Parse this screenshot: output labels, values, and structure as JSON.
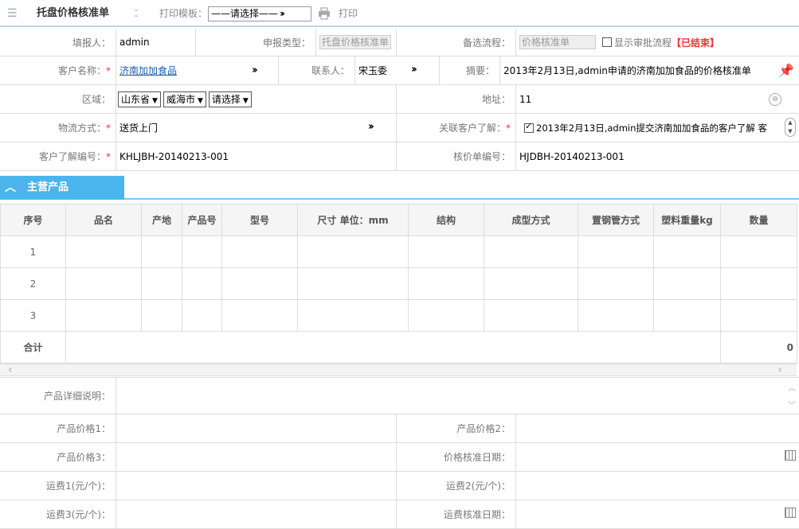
{
  "toolbar": {
    "title": "托盘价格核准单",
    "print_template_label": "打印模板：",
    "print_template_value": "——请选择——",
    "print_label": "打印"
  },
  "form": {
    "reporter_label": "填报人：",
    "reporter_value": "admin",
    "report_type_label": "申报类型：",
    "report_type_value": "托盘价格核准单",
    "alt_flow_label": "备选流程：",
    "alt_flow_value": "价格核准单",
    "show_flow_label": "显示审批流程",
    "status_text": "【已结束】",
    "customer_label": "客户名称：",
    "customer_value": "济南加加食品",
    "contact_label": "联系人：",
    "contact_value": "宋玉委",
    "summary_label": "摘要：",
    "summary_value": "2013年2月13日,admin申请的济南加加食品的价格核准单",
    "region_label": "区域：",
    "province": "山东省",
    "city": "威海市",
    "district": "请选择",
    "address_label": "地址：",
    "address_value": "11",
    "logistics_label": "物流方式：",
    "logistics_value": "送货上门",
    "related_label": "关联客户了解：",
    "related_value": "2013年2月13日,admin提交济南加加食品的客户了解 客",
    "understand_no_label": "客户了解编号：",
    "understand_no_value": "KHLJBH-20140213-001",
    "price_no_label": "核价单编号：",
    "price_no_value": "HJDBH-20140213-001"
  },
  "section": {
    "title": "主营产品"
  },
  "table": {
    "headers": [
      "序号",
      "品名",
      "产地",
      "产品号",
      "型号",
      "尺寸 单位：mm",
      "结构",
      "成型方式",
      "置钢管方式",
      "塑料重量kg",
      "数量"
    ],
    "rows": [
      "1",
      "2",
      "3"
    ],
    "total_label": "合计",
    "total_value": "0"
  },
  "details": {
    "desc_label": "产品详细说明：",
    "price1_label": "产品价格1：",
    "price2_label": "产品价格2：",
    "price3_label": "产品价格3：",
    "price_date_label": "价格核准日期：",
    "fee1_label": "运费1(元/个)：",
    "fee2_label": "运费2(元/个)：",
    "fee3_label": "运费3(元/个)：",
    "fee_date_label": "运费核准日期："
  }
}
